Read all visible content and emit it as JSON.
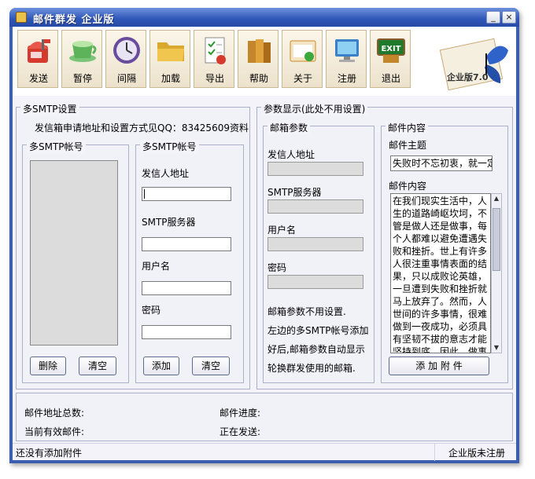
{
  "window": {
    "title": "邮件群发 企业版",
    "min_label": "_",
    "max_label": "□",
    "close_label": "×"
  },
  "toolbar": {
    "items": [
      {
        "label": "发送",
        "icon": "mailbox-icon"
      },
      {
        "label": "暂停",
        "icon": "teacup-icon"
      },
      {
        "label": "间隔",
        "icon": "clock-icon"
      },
      {
        "label": "加载",
        "icon": "folder-icon"
      },
      {
        "label": "导出",
        "icon": "checklist-icon"
      },
      {
        "label": "帮助",
        "icon": "books-icon"
      },
      {
        "label": "关于",
        "icon": "document-icon"
      },
      {
        "label": "注册",
        "icon": "computer-icon"
      },
      {
        "label": "退出",
        "icon": "exit-sign-icon"
      }
    ],
    "badge_text": "企业版7.0"
  },
  "smtp": {
    "group_title": "多SMTP设置",
    "info": "发信箱申请地址和设置方式见QQ：83425609资料",
    "list_title": "多SMTP帐号",
    "form_title": "多SMTP帐号",
    "sender_label": "发信人地址",
    "server_label": "SMTP服务器",
    "user_label": "用户名",
    "password_label": "密码",
    "delete_button": "删除",
    "clear_button": "清空",
    "add_button": "添加",
    "clear2_button": "清空"
  },
  "params": {
    "group_title": "参数显示(此处不用设置)",
    "mailbox_title": "邮箱参数",
    "sender_label": "发信人地址",
    "server_label": "SMTP服务器",
    "user_label": "用户名",
    "password_label": "密码",
    "note_lines": [
      "邮箱参数不用设置.",
      "左边的多SMTP帐号添加",
      "好后,邮箱参数自动显示",
      "轮换群发使用的邮箱."
    ]
  },
  "mail": {
    "title": "邮件内容",
    "subject_label": "邮件主题",
    "subject_value": "失败时不忘初衷，就一定",
    "content_label": "邮件内容",
    "content_value": "在我们现实生活中，人生的道路崎岖坎坷，不管是做人还是做事，每个人都难以避免遭遇失败和挫折。世上有许多人很注重事情表面的结果，只以成败论英雄，一旦遭到失败和挫折就马上放弃了。然而，人世间的许多事情，很难做到一夜成功，必须具有坚韧不拔的意志才能坚持到底。因此，做事的过程才是最重要的。一个人如果在失败时不忘初衷，具备了跌倒之",
    "attach_button": "添 加 附 件"
  },
  "progress": {
    "total_label": "邮件地址总数:",
    "valid_label": "当前有效邮件:",
    "progress_label": "邮件进度:",
    "sending_label": "正在发送:"
  },
  "status": {
    "left": "还没有添加附件",
    "right": "企业版未注册"
  }
}
